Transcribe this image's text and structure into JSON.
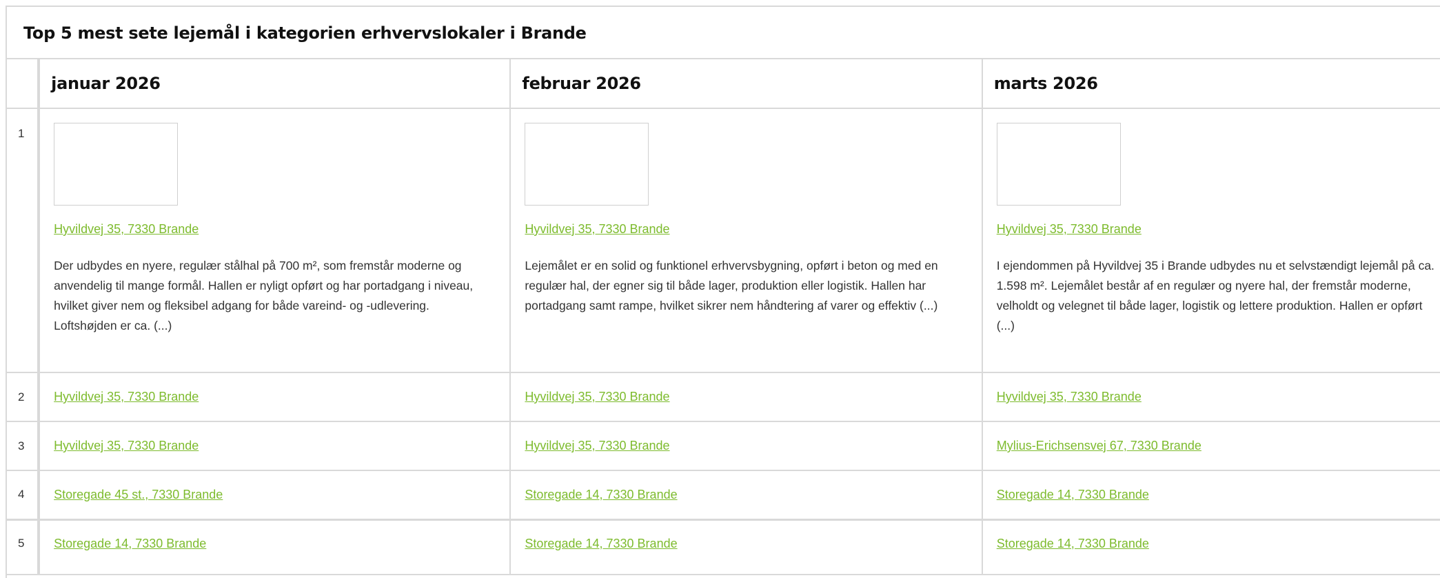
{
  "title": "Top 5 mest sete lejemål i kategorien erhvervslokaler i Brande",
  "months": [
    "januar 2026",
    "februar 2026",
    "marts 2026"
  ],
  "rows": [
    {
      "rank": "1",
      "cells": [
        {
          "address": "Hyvildvej 35, 7330 Brande",
          "description": "Der udbydes en nyere, regulær stålhal på 700 m², som fremstår moderne og anvendelig til mange formål. Hallen er nyligt opført og har portadgang i niveau, hvilket giver nem og fleksibel adgang for både vareind- og -udlevering. Loftshøjden er ca. (...)"
        },
        {
          "address": "Hyvildvej 35, 7330 Brande",
          "description": "Lejemålet er en solid og funktionel erhvervsbygning, opført i beton og med en regulær hal, der egner sig til både lager, produktion eller logistik. Hallen har portadgang samt rampe, hvilket sikrer nem håndtering af varer og effektiv (...)"
        },
        {
          "address": "Hyvildvej 35, 7330 Brande",
          "description": "I ejendommen på Hyvildvej 35 i Brande udbydes nu et selvstændigt lejemål på ca. 1.598 m². Lejemålet består af en regulær og nyere hal, der fremstår moderne, velholdt og velegnet til både lager, logistik og lettere produktion. Hallen er opført (...)"
        }
      ]
    },
    {
      "rank": "2",
      "cells": [
        {
          "address": "Hyvildvej 35, 7330 Brande"
        },
        {
          "address": "Hyvildvej 35, 7330 Brande"
        },
        {
          "address": "Hyvildvej 35, 7330 Brande"
        }
      ]
    },
    {
      "rank": "3",
      "cells": [
        {
          "address": "Hyvildvej 35, 7330 Brande"
        },
        {
          "address": "Hyvildvej 35, 7330 Brande"
        },
        {
          "address": "Mylius-Erichsensvej 67, 7330 Brande"
        }
      ]
    },
    {
      "rank": "4",
      "cells": [
        {
          "address": "Storegade 45 st., 7330 Brande"
        },
        {
          "address": "Storegade 14, 7330 Brande"
        },
        {
          "address": "Storegade 14, 7330 Brande"
        }
      ]
    },
    {
      "rank": "5",
      "cells": [
        {
          "address": "Storegade 14, 7330 Brande"
        },
        {
          "address": "Storegade 14, 7330 Brande"
        },
        {
          "address": "Storegade 14, 7330 Brande"
        }
      ]
    }
  ],
  "colors": {
    "link": "#7dbb2d",
    "border": "#d9d9d9",
    "text": "#333333"
  }
}
